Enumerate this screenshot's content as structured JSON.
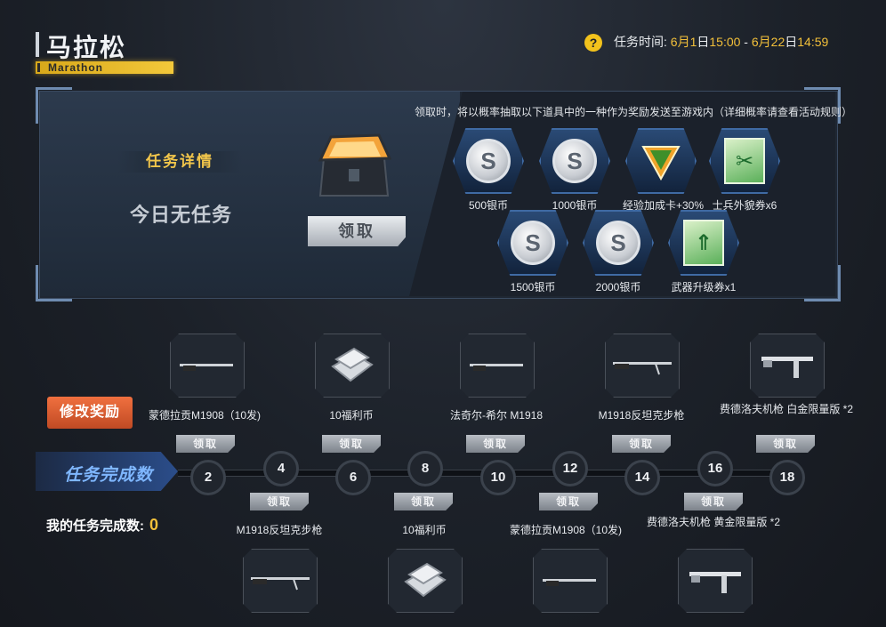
{
  "header": {
    "title": "马拉松",
    "subtitle": "Marathon",
    "time_label": "任务时间:",
    "start_month": "6月",
    "start_day": "1",
    "start_day_unit": "日",
    "start_time": "15:00",
    "separator": " - ",
    "end_month": "6月",
    "end_day": "22",
    "end_day_unit": "日",
    "end_time": "14:59",
    "help_icon": "?"
  },
  "details": {
    "section_title": "任务详情",
    "no_task_text": "今日无任务",
    "claim_button": "领取",
    "notice": "领取时，将以概率抽取以下道具中的一种作为奖励发送至游戏内（详细概率请查看活动规则）",
    "rewards": [
      {
        "icon": "silver-coin-icon",
        "glyph": "S",
        "label": "500银币"
      },
      {
        "icon": "silver-coin-icon",
        "glyph": "S",
        "label": "1000银币"
      },
      {
        "icon": "xp-card-icon",
        "glyph": "XP",
        "label": "经验加成卡+30%"
      },
      {
        "icon": "soldier-voucher-icon",
        "glyph": "✂",
        "label": "士兵外貌券x6"
      },
      {
        "icon": "silver-coin-icon",
        "glyph": "S",
        "label": "1500银币"
      },
      {
        "icon": "silver-coin-icon",
        "glyph": "S",
        "label": "2000银币"
      },
      {
        "icon": "weapon-upgrade-icon",
        "glyph": "⇑",
        "label": "武器升级券x1"
      }
    ]
  },
  "timeline": {
    "edit_reward_button": "修改奖励",
    "label": "任务完成数",
    "my_count_label": "我的任务完成数:",
    "my_count_value": "0",
    "claim_label": "领取",
    "milestones": [
      "2",
      "4",
      "6",
      "8",
      "10",
      "12",
      "14",
      "16",
      "18"
    ],
    "top_rewards": [
      {
        "label": "蒙德拉贡M1908（10发)",
        "icon": "rifle-icon"
      },
      {
        "label": "10福利币",
        "icon": "welfare-coin-icon"
      },
      {
        "label": "法奇尔-希尔 M1918",
        "icon": "rifle-icon"
      },
      {
        "label": "M1918反坦克步枪",
        "icon": "antitank-rifle-icon"
      },
      {
        "label": "费德洛夫机枪 白金限量版 *2",
        "icon": "machine-gun-icon"
      }
    ],
    "bottom_rewards": [
      {
        "label": "M1918反坦克步枪",
        "icon": "antitank-rifle-icon"
      },
      {
        "label": "10福利币",
        "icon": "welfare-coin-icon"
      },
      {
        "label": "蒙德拉贡M1908（10发)",
        "icon": "rifle-icon"
      },
      {
        "label": "费德洛夫机枪 黄金限量版 *2",
        "icon": "machine-gun-icon"
      }
    ]
  },
  "colors": {
    "accent": "#f3c03a",
    "button_orange": "#e0602f",
    "node_border": "#3b424c"
  }
}
